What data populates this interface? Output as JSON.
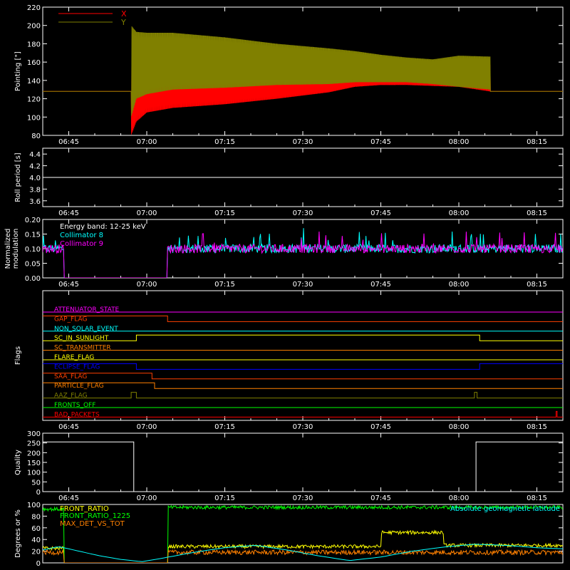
{
  "chart_data": [
    {
      "type": "line",
      "ylabel": "Pointing [\"]",
      "ylim": [
        80,
        220
      ],
      "yticks": [
        80,
        100,
        120,
        140,
        160,
        180,
        200,
        220
      ],
      "xticks": [
        "06:45",
        "07:00",
        "07:15",
        "07:30",
        "07:45",
        "08:00",
        "08:15"
      ],
      "xlim_minutes": [
        -55,
        45
      ],
      "grid": false,
      "legend_position": "top-left",
      "series": [
        {
          "name": "X",
          "color": "#ff0000",
          "x_minutes": [
            -55,
            -38,
            -38,
            -37,
            -35,
            -30,
            -20,
            -10,
            0,
            5,
            10,
            15,
            20,
            25,
            31,
            31,
            45
          ],
          "upper": [
            128,
            128,
            175,
            170,
            168,
            165,
            160,
            157,
            150,
            150,
            150,
            151,
            155,
            160,
            157,
            128,
            128
          ],
          "lower": [
            128,
            128,
            80,
            95,
            105,
            110,
            114,
            120,
            127,
            133,
            135,
            135,
            134,
            133,
            128,
            128,
            128
          ]
        },
        {
          "name": "Y",
          "color": "#808000",
          "x_minutes": [
            -55,
            -38,
            -38,
            -37,
            -35,
            -30,
            -20,
            -10,
            0,
            5,
            10,
            15,
            20,
            25,
            31,
            31,
            45
          ],
          "upper": [
            128,
            128,
            200,
            193,
            192,
            192,
            187,
            180,
            175,
            172,
            168,
            165,
            163,
            167,
            166,
            128,
            128
          ],
          "lower": [
            128,
            128,
            100,
            120,
            125,
            130,
            132,
            135,
            136,
            138,
            138,
            138,
            136,
            133,
            130,
            128,
            128
          ]
        }
      ]
    },
    {
      "type": "line",
      "ylabel": "Roll period [s]",
      "ylim": [
        3.5,
        4.5
      ],
      "yticks": [
        3.6,
        3.8,
        4.0,
        4.2,
        4.4
      ],
      "xticks": [
        "06:45",
        "07:00",
        "07:15",
        "07:30",
        "07:45",
        "08:00",
        "08:15"
      ],
      "xlim_minutes": [
        -55,
        45
      ],
      "series": [
        {
          "name": "",
          "color": "#ffffff",
          "x_minutes": [
            -55,
            45
          ],
          "values": [
            4.0,
            4.0
          ]
        }
      ]
    },
    {
      "type": "line",
      "ylabel": "Normalized modulation",
      "ylim": [
        0,
        0.2
      ],
      "yticks": [
        0.0,
        0.05,
        0.1,
        0.15,
        0.2
      ],
      "xticks": [
        "06:45",
        "07:00",
        "07:15",
        "07:30",
        "07:45",
        "08:00",
        "08:15"
      ],
      "xlim_minutes": [
        -55,
        45
      ],
      "annotation": "Energy band: 12-25 keV",
      "series": [
        {
          "name": "Collimator 8",
          "color": "#00ffff",
          "gaps_minutes": [
            [
              -51,
              -31
            ]
          ],
          "level": 0.1,
          "noise": 0.015
        },
        {
          "name": "Collimator 9",
          "color": "#ff00ff",
          "gaps_minutes": [
            [
              -51,
              -31
            ]
          ],
          "level": 0.1,
          "noise": 0.015
        }
      ]
    },
    {
      "type": "line",
      "ylabel": "Flags",
      "xticks": [
        "06:45",
        "07:00",
        "07:15",
        "07:30",
        "07:45",
        "08:00",
        "08:15"
      ],
      "xlim_minutes": [
        -55,
        45
      ],
      "series": [
        {
          "name": "ATTENUATOR_STATE",
          "color": "#ff00ff",
          "steps": [
            [
              -55,
              0
            ]
          ]
        },
        {
          "name": "GAP_FLAG",
          "color": "#ff4000",
          "steps": [
            [
              -55,
              1
            ],
            [
              -31,
              0
            ]
          ]
        },
        {
          "name": "NON_SOLAR_EVENT",
          "color": "#00ffff",
          "steps": [
            [
              -55,
              0
            ]
          ]
        },
        {
          "name": "SC_IN_SUNLIGHT",
          "color": "#ffff00",
          "steps": [
            [
              -55,
              0
            ],
            [
              -37,
              1
            ],
            [
              29,
              0
            ]
          ]
        },
        {
          "name": "SC_TRANSMITTER",
          "color": "#ff8000",
          "steps": [
            [
              -55,
              0
            ]
          ]
        },
        {
          "name": "FLARE_FLAG",
          "color": "#ffff00",
          "steps": [
            [
              -55,
              0
            ]
          ]
        },
        {
          "name": "ECLIPSE_FLAG",
          "color": "#0000ff",
          "steps": [
            [
              -55,
              1
            ],
            [
              -37,
              0
            ],
            [
              29,
              1
            ]
          ]
        },
        {
          "name": "SAA_FLAG",
          "color": "#ff4000",
          "steps": [
            [
              -55,
              1
            ],
            [
              -34,
              0
            ]
          ]
        },
        {
          "name": "PARTICLE_FLAG",
          "color": "#ff8000",
          "steps": [
            [
              -55,
              1
            ],
            [
              -33.5,
              0
            ]
          ]
        },
        {
          "name": "AAZ_FLAG",
          "color": "#808000",
          "steps": [
            [
              -55,
              0
            ],
            [
              -38,
              1
            ],
            [
              -37,
              0
            ],
            [
              28,
              1
            ],
            [
              28.5,
              0
            ]
          ]
        },
        {
          "name": "FRONTS_OFF",
          "color": "#00ff00",
          "steps": [
            [
              -55,
              0
            ]
          ]
        },
        {
          "name": "BAD_PACKETS",
          "color": "#ff0000",
          "steps": [
            [
              -55,
              0
            ],
            [
              43.7,
              1
            ],
            [
              43.9,
              0
            ]
          ]
        }
      ]
    },
    {
      "type": "line",
      "ylabel": "Quality",
      "ylim": [
        0,
        300
      ],
      "yticks": [
        0,
        50,
        100,
        150,
        200,
        250,
        300
      ],
      "xticks": [
        "06:45",
        "07:00",
        "07:15",
        "07:30",
        "07:45",
        "08:00",
        "08:15"
      ],
      "xlim_minutes": [
        -55,
        45
      ],
      "series": [
        {
          "name": "",
          "color": "#ffffff",
          "x_minutes": [
            -55,
            -37.5,
            -37.5,
            28.3,
            28.3,
            45
          ],
          "values": [
            255,
            255,
            0,
            0,
            255,
            255
          ]
        }
      ]
    },
    {
      "type": "line",
      "ylabel": "Degrees or %",
      "ylim": [
        0,
        100
      ],
      "yticks": [
        0,
        20,
        40,
        60,
        80,
        100
      ],
      "xlim_minutes": [
        -55,
        45
      ],
      "series": [
        {
          "name": "FRONT_RATIO",
          "color": "#ffff00",
          "x_minutes": [
            -55,
            -51,
            -50.9,
            -31,
            -31,
            10,
            10,
            22,
            22,
            45
          ],
          "values": [
            25,
            25,
            0,
            0,
            28,
            28,
            52,
            52,
            30,
            30
          ]
        },
        {
          "name": "FRONT_RATIO_1225",
          "color": "#00ff00",
          "x_minutes": [
            -55,
            -51,
            -50.9,
            -31,
            -31,
            45
          ],
          "values": [
            92,
            92,
            0,
            0,
            95,
            95
          ]
        },
        {
          "name": "MAX_DET_VS_TOT",
          "color": "#ff8000",
          "x_minutes": [
            -55,
            -51,
            -50.9,
            -31,
            -31,
            45
          ],
          "values": [
            18,
            18,
            0,
            0,
            18,
            18
          ]
        },
        {
          "name": "Absolute geomagnetic latitude",
          "color": "#00ffff",
          "x_minutes": [
            -55,
            -52,
            -48,
            -44,
            -40,
            -36,
            -32,
            -26,
            -20,
            -14,
            -8,
            -2,
            4,
            10,
            16,
            22,
            28,
            34,
            40,
            45
          ],
          "values": [
            22,
            28,
            20,
            12,
            6,
            2,
            8,
            18,
            26,
            30,
            22,
            12,
            4,
            10,
            20,
            27,
            32,
            30,
            26,
            24
          ]
        }
      ]
    }
  ]
}
